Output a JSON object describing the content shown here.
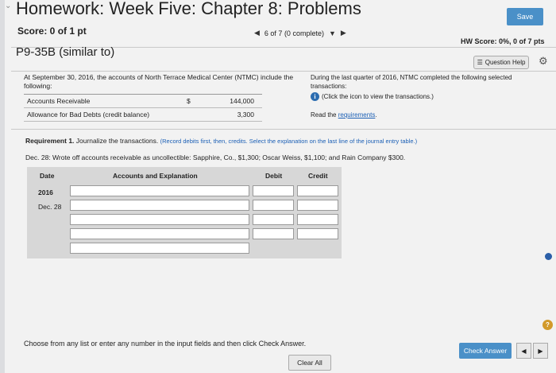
{
  "header": {
    "title": "Homework: Week Five: Chapter 8: Problems",
    "save_label": "Save",
    "score": "Score: 0 of 1 pt",
    "nav_text": "6 of 7 (0 complete)",
    "hw_score": "HW Score: 0%, 0 of 7 pts"
  },
  "problem": {
    "id": "P9-35B (similar to)",
    "help_label": "Question Help"
  },
  "intro": "At September 30, 2016, the accounts of North Terrace Medical Center (NTMC) include the following:",
  "accounts": [
    {
      "name": "Accounts Receivable",
      "dollar": "$",
      "value": "144,000"
    },
    {
      "name": "Allowance for Bad Debts (credit balance)",
      "dollar": "",
      "value": "3,300"
    }
  ],
  "right": {
    "quarter_text": "During the last quarter of 2016, NTMC completed the following selected transactions:",
    "click_text": "(Click the icon to view the transactions.)",
    "read_text": "Read the ",
    "req_link": "requirements"
  },
  "requirement": {
    "label": "Requirement 1.",
    "text": " Journalize the transactions. ",
    "hint": "(Record debits first, then, credits. Select the explanation on the last line of the journal entry table.)",
    "dec": "Dec. 28: Wrote off accounts receivable as uncollectible: Sapphire, Co., $1,300; Oscar Weiss, $1,100; and Rain Company $300."
  },
  "journal": {
    "col_date": "Date",
    "col_accounts": "Accounts and Explanation",
    "col_debit": "Debit",
    "col_credit": "Credit",
    "year": "2016",
    "date": "Dec. 28"
  },
  "footer": {
    "hint": "Choose from any list or enter any number in the input fields and then click Check Answer.",
    "check_label": "Check Answer",
    "clear_label": "Clear All",
    "prev": "◀",
    "next": "▶"
  },
  "colors": {
    "accent": "#4a90c8",
    "link": "#1b5fb5"
  }
}
